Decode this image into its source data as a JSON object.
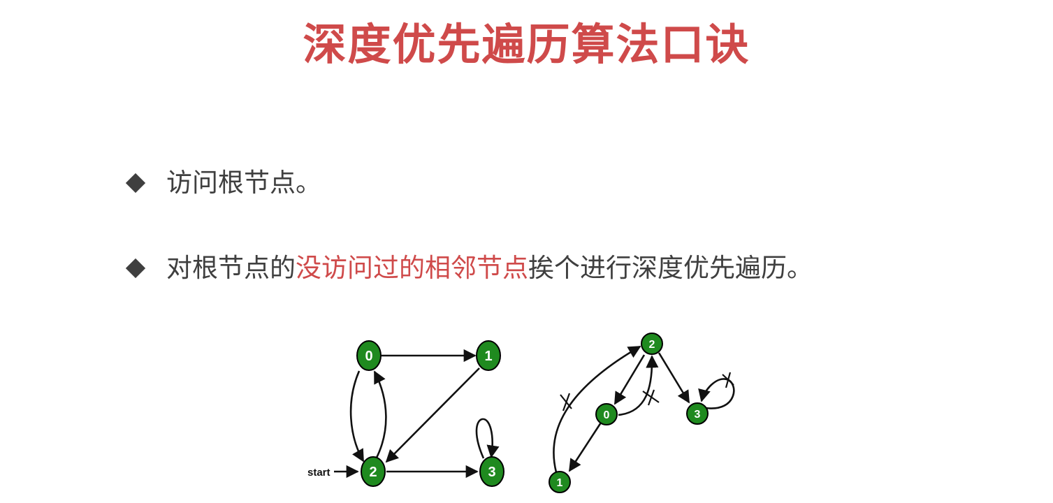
{
  "title": "深度优先遍历算法口诀",
  "bullets": [
    {
      "text": "访问根节点。"
    },
    {
      "text_before": "对根节点的",
      "text_highlight": "没访问过的相邻节点",
      "text_after": "挨个进行深度优先遍历。"
    }
  ],
  "colors": {
    "title": "#cf4a4a",
    "highlight": "#cf4a4a",
    "body_text": "#3f3f3f",
    "node_fill": "#1f8a1f"
  },
  "graph_left": {
    "start_label": "start",
    "nodes": [
      "0",
      "1",
      "2",
      "3"
    ]
  },
  "graph_right": {
    "nodes": [
      "2",
      "0",
      "3",
      "1"
    ]
  }
}
